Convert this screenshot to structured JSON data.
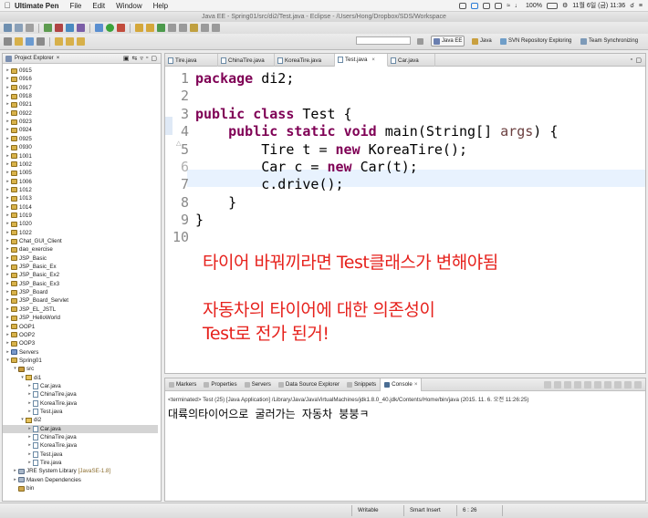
{
  "menubar": {
    "app": "Ultimate Pen",
    "menus": [
      "File",
      "Edit",
      "Window",
      "Help"
    ],
    "battery": "100%",
    "clock": "11월 6일 (금) 11:36"
  },
  "window_title": "Java EE - Spring01/src/di2/Test.java - Eclipse - /Users/Hong/Dropbox/SDS/Workspace",
  "perspectives": {
    "java_ee": "Java EE",
    "java": "Java",
    "svn": "SVN Repository Exploring",
    "team": "Team Synchronizing"
  },
  "explorer": {
    "title": "Project Explorer",
    "items": [
      {
        "label": "0915",
        "suffix": ""
      },
      {
        "label": "0916",
        "suffix": ""
      },
      {
        "label": "0917",
        "suffix": ""
      },
      {
        "label": "0918",
        "suffix": ""
      },
      {
        "label": "0921",
        "suffix": ""
      },
      {
        "label": "0922",
        "suffix": ""
      },
      {
        "label": "0923",
        "suffix": ""
      },
      {
        "label": "0924",
        "suffix": ""
      },
      {
        "label": "0925",
        "suffix": ""
      },
      {
        "label": "0930",
        "suffix": ""
      },
      {
        "label": "1001",
        "suffix": ""
      },
      {
        "label": "1002",
        "suffix": ""
      },
      {
        "label": "1005",
        "suffix": ""
      },
      {
        "label": "1006",
        "suffix": ""
      },
      {
        "label": "1012",
        "suffix": ""
      },
      {
        "label": "1013",
        "suffix": ""
      },
      {
        "label": "1014",
        "suffix": ""
      },
      {
        "label": "1019",
        "suffix": ""
      },
      {
        "label": "1020",
        "suffix": ""
      },
      {
        "label": "1022",
        "suffix": ""
      },
      {
        "label": "Chat_GUI_Client",
        "suffix": ""
      },
      {
        "label": "dao_exercise",
        "suffix": ""
      },
      {
        "label": "JSP_Basic",
        "suffix": ""
      },
      {
        "label": "JSP_Basic_Ex",
        "suffix": ""
      },
      {
        "label": "JSP_Basic_Ex2",
        "suffix": ""
      },
      {
        "label": "JSP_Basic_Ex3",
        "suffix": ""
      },
      {
        "label": "JSP_Board",
        "suffix": ""
      },
      {
        "label": "JSP_Board_Servlet",
        "suffix": ""
      },
      {
        "label": "JSP_EL_JSTL",
        "suffix": ""
      },
      {
        "label": "JSP_HelloWorld",
        "suffix": ""
      },
      {
        "label": "OOP1",
        "suffix": ""
      },
      {
        "label": "OOP2",
        "suffix": ""
      },
      {
        "label": "OOP3",
        "suffix": ""
      },
      {
        "label": "Servers",
        "suffix": ""
      },
      {
        "label": "Spring01",
        "suffix": ""
      },
      {
        "label": "src",
        "suffix": ""
      },
      {
        "label": "di1",
        "suffix": ""
      },
      {
        "label": "Car.java",
        "suffix": ""
      },
      {
        "label": "ChinaTire.java",
        "suffix": ""
      },
      {
        "label": "KoreaTire.java",
        "suffix": ""
      },
      {
        "label": "Test.java",
        "suffix": ""
      },
      {
        "label": "di2",
        "suffix": ""
      },
      {
        "label": "Car.java",
        "suffix": ""
      },
      {
        "label": "ChinaTire.java",
        "suffix": ""
      },
      {
        "label": "KoreaTire.java",
        "suffix": ""
      },
      {
        "label": "Test.java",
        "suffix": ""
      },
      {
        "label": "Tire.java",
        "suffix": ""
      },
      {
        "label": "JRE System Library",
        "suffix": "[JavaSE-1.8]"
      },
      {
        "label": "Maven Dependencies",
        "suffix": ""
      },
      {
        "label": "bin",
        "suffix": ""
      }
    ]
  },
  "editor": {
    "tabs": [
      "Tire.java",
      "ChinaTire.java",
      "KoreaTire.java",
      "Test.java",
      "Car.java"
    ],
    "line_numbers": [
      "1",
      "2",
      "3",
      "4",
      "5",
      "6",
      "7",
      "8",
      "9",
      "10"
    ],
    "code": {
      "l1_kw": "package",
      "l1_rest": " di2;",
      "l3_kw1": "public",
      "l3_kw2": "class",
      "l3_rest": " Test {",
      "l4_indent": "    ",
      "l4_kw1": "public",
      "l4_kw2": "static",
      "l4_kw3": "void",
      "l4_mid": " main(String[] ",
      "l4_param": "args",
      "l4_end": ") {",
      "l5_a": "        Tire t = ",
      "l5_kw": "new",
      "l5_b": " KoreaTire();",
      "l6_a": "        Car c = ",
      "l6_kw": "new",
      "l6_b": " Car(t);",
      "l7": "        c.drive();",
      "l8": "    }",
      "l9": "}"
    },
    "annotations": [
      "타이어 바꿔끼라면 Test클래스가 변해야됨",
      "자동차의 타이어에 대한 의존성이",
      "Test로 전가 된거!"
    ]
  },
  "console": {
    "tabs": [
      "Markers",
      "Properties",
      "Servers",
      "Data Source Explorer",
      "Snippets",
      "Console"
    ],
    "terminated": "<terminated> Test (25) [Java Application] /Library/Java/JavaVirtualMachines/jdk1.8.0_40.jdk/Contents/Home/bin/java (2015. 11. 6. 오전 11:26:25)",
    "output": "대륙의타이어으로 굴러가는 자동차 붕붕ㅋ"
  },
  "statusbar": {
    "mode": "Writable",
    "insert": "Smart Insert",
    "position": "6 : 26"
  }
}
